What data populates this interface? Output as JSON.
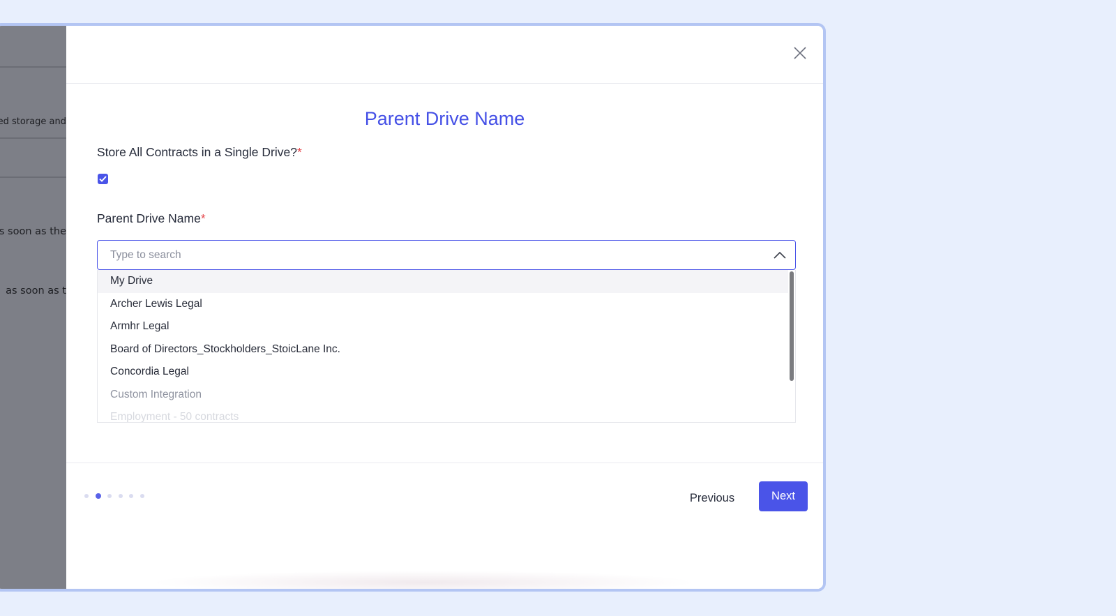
{
  "backdrop": {
    "texts": [
      "ed storage and",
      "s soon as the",
      "as soon as t"
    ]
  },
  "modal": {
    "title": "Parent Drive Name",
    "single_drive": {
      "label": "Store All Contracts in a Single Drive?",
      "required_mark": "*",
      "checked": true
    },
    "parent_drive": {
      "label": "Parent Drive Name",
      "required_mark": "*",
      "search_placeholder": "Type to search",
      "search_value": "",
      "dropdown_open": true,
      "options": [
        "My Drive",
        "Archer Lewis Legal",
        "Armhr Legal",
        "Board of Directors_Stockholders_StoicLane Inc.",
        "Concordia Legal",
        "Custom Integration",
        "Employment - 50 contracts"
      ],
      "highlighted_option": "My Drive"
    },
    "stepper": {
      "total_steps": 6,
      "current_step": 2
    },
    "buttons": {
      "previous_label": "Previous",
      "next_label": "Next"
    }
  },
  "colors": {
    "accent": "#4a54e8",
    "title": "#4550e6",
    "required": "#e5484d",
    "page_background": "#e8effd",
    "frame_border": "#b3c5f3"
  }
}
